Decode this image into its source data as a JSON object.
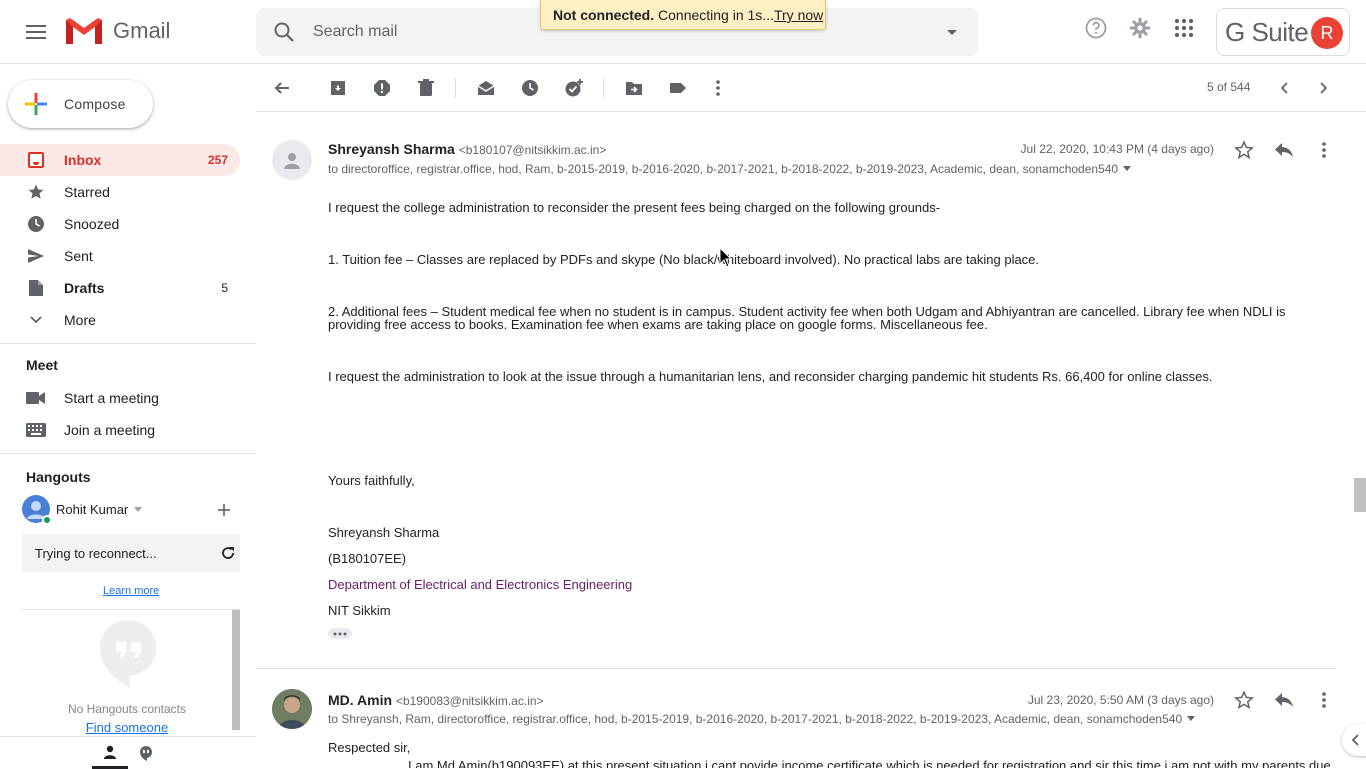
{
  "header": {
    "app_name": "Gmail",
    "search_placeholder": "Search mail",
    "suite_label": "G Suite",
    "avatar_initial": "R",
    "icons": [
      "menu-icon",
      "gmail-logo",
      "search-icon",
      "search-options-icon",
      "help-icon",
      "settings-icon",
      "apps-icon"
    ]
  },
  "toast": {
    "status": "Not connected.",
    "message": "Connecting in 1s...",
    "action": "Try now"
  },
  "sidebar": {
    "compose_label": "Compose",
    "items": [
      {
        "label": "Inbox",
        "count": "257",
        "icon": "inbox-icon"
      },
      {
        "label": "Starred",
        "count": "",
        "icon": "star-icon"
      },
      {
        "label": "Snoozed",
        "count": "",
        "icon": "clock-icon"
      },
      {
        "label": "Sent",
        "count": "",
        "icon": "send-icon"
      },
      {
        "label": "Drafts",
        "count": "5",
        "icon": "draft-icon"
      },
      {
        "label": "More",
        "count": "",
        "icon": "chevron-down-icon"
      }
    ],
    "meet": {
      "title": "Meet",
      "start": "Start a meeting",
      "join": "Join a meeting"
    },
    "hangouts": {
      "title": "Hangouts",
      "user": "Rohit Kumar",
      "reconnect": "Trying to reconnect...",
      "learn_more": "Learn more",
      "no_contacts": "No Hangouts contacts",
      "find_someone": "Find someone"
    }
  },
  "toolbar": {
    "pager": "5 of 544",
    "icons": [
      "back-arrow-icon",
      "archive-icon",
      "report-spam-icon",
      "delete-icon",
      "mark-unread-icon",
      "snooze-icon",
      "add-task-icon",
      "move-to-icon",
      "label-icon",
      "more-vert-icon",
      "newer-icon",
      "older-icon"
    ]
  },
  "messages": [
    {
      "sender_name": "Shreyansh Sharma",
      "sender_email": "<b180107@nitsikkim.ac.in>",
      "recipients": "to directoroffice, registrar.office, hod, Ram, b-2015-2019, b-2016-2020, b-2017-2021, b-2018-2022, b-2019-2023, Academic, dean, sonamchoden540",
      "date": "Jul 22, 2020, 10:43 PM (4 days ago)",
      "body": {
        "p1": " I request the college administration to reconsider the present fees being charged on the following grounds-",
        "p2": "1. Tuition fee – Classes are replaced by PDFs and skype (No black/whiteboard involved). No practical labs are taking place.",
        "p3a": "2. Additional fees – Student medical fee when no student is in campus. Student activity fee when both Udgam and Abhiyantran are cancelled. Library fee when NDLI is",
        "p3b": "providing free access to books. Examination fee when exams are taking place on google forms. Miscellaneous fee.",
        "p4": "I request the administration to look at the issue through a humanitarian lens, and reconsider charging pandemic hit students Rs. 66,400 for online classes.",
        "closing": "Yours faithfully,",
        "sig_name": "Shreyansh Sharma",
        "sig_id": "(B180107EE)",
        "sig_dept": "Department of Electrical and Electronics Engineering",
        "sig_inst": "NIT Sikkim"
      }
    },
    {
      "sender_name": "MD. Amin",
      "sender_email": "<b190083@nitsikkim.ac.in>",
      "recipients": "to Shreyansh, Ram, directoroffice, registrar.office, hod, b-2015-2019, b-2016-2020, b-2017-2021, b-2018-2022, b-2019-2023, Academic, dean, sonamchoden540",
      "date": "Jul 23, 2020, 5:50 AM (3 days ago)",
      "body": {
        "greeting": "Respected sir,",
        "line1": "I am Md Amin(b190093EE) at this present situation i cant povide income certificate which is needed for registration and sir this time i am not with my parents due"
      }
    }
  ],
  "colors": {
    "accent_red": "#d93025",
    "inbox_bg": "#fce8e6",
    "link_blue": "#1a73e8",
    "toast_bg": "#fef0c3"
  }
}
